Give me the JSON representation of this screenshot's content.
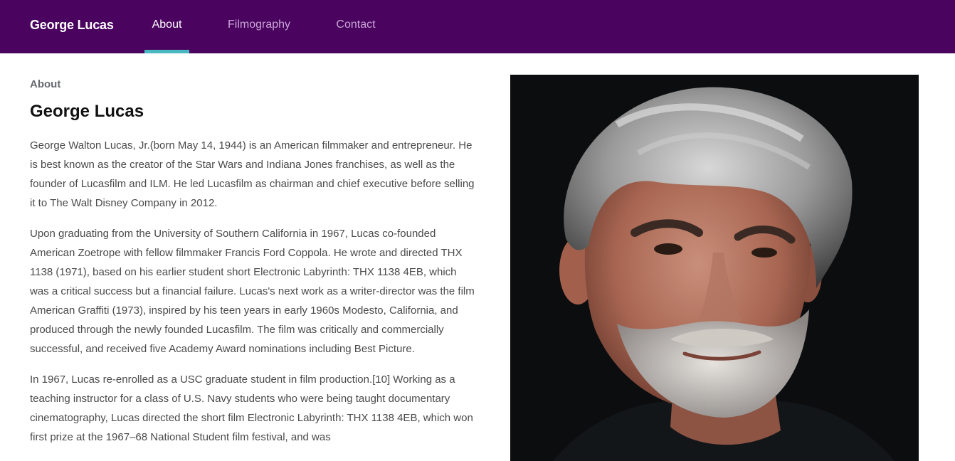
{
  "nav": {
    "brand": "George Lucas",
    "tabs": [
      {
        "label": "About",
        "active": true
      },
      {
        "label": "Filmography",
        "active": false
      },
      {
        "label": "Contact",
        "active": false
      }
    ]
  },
  "colors": {
    "header_bg": "#4a035f",
    "active_indicator": "#4ab8c1",
    "body_text": "#4a4a4a"
  },
  "main": {
    "eyebrow": "About",
    "title": "George Lucas",
    "paragraphs": [
      "George Walton Lucas, Jr.(born May 14, 1944) is an American filmmaker and entrepreneur. He is best known as the creator of the Star Wars and Indiana Jones franchises, as well as the founder of Lucasfilm and ILM. He led Lucasfilm as chairman and chief executive before selling it to The Walt Disney Company in 2012.",
      "Upon graduating from the University of Southern California in 1967, Lucas co-founded American Zoetrope with fellow filmmaker Francis Ford Coppola. He wrote and directed THX 1138 (1971), based on his earlier student short Electronic Labyrinth: THX 1138 4EB, which was a critical success but a financial failure. Lucas's next work as a writer-director was the film American Graffiti (1973), inspired by his teen years in early 1960s Modesto, California, and produced through the newly founded Lucasfilm. The film was critically and commercially successful, and received five Academy Award nominations including Best Picture.",
      "In 1967, Lucas re-enrolled as a USC graduate student in film production.[10] Working as a teaching instructor for a class of U.S. Navy students who were being taught documentary cinematography, Lucas directed the short film Electronic Labyrinth: THX 1138 4EB, which won first prize at the 1967–68 National Student film festival, and was"
    ]
  },
  "portrait": {
    "subject": "portrait photo of a grey-haired bearded man on a dark background"
  }
}
